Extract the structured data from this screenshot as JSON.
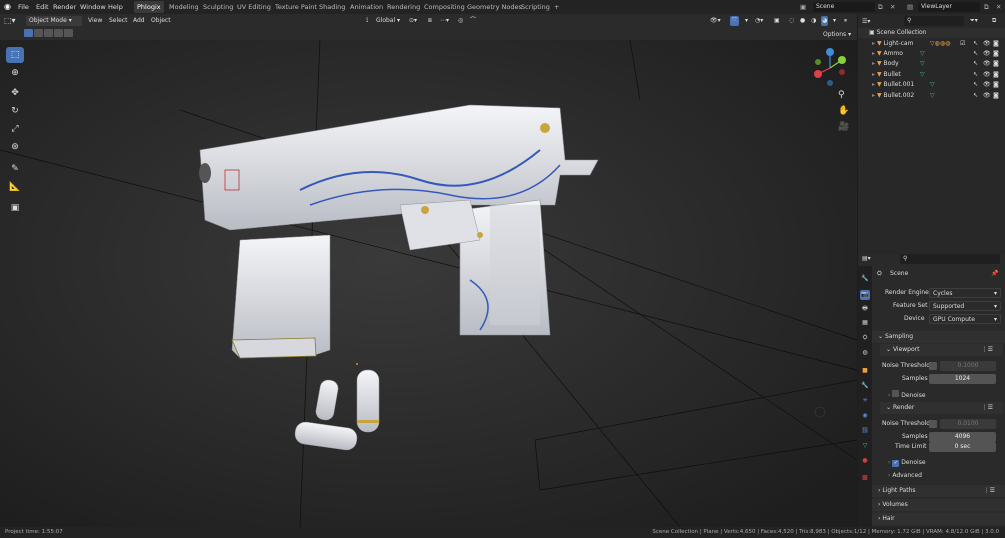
{
  "topbar": {
    "menus": [
      "File",
      "Edit",
      "Render",
      "Window",
      "Help"
    ],
    "workspaces": [
      "Phlogix",
      "Modeling",
      "Sculpting",
      "UV Editing",
      "Texture Paint",
      "Shading",
      "Animation",
      "Rendering",
      "Compositing",
      "Geometry Nodes",
      "Scripting"
    ],
    "active_workspace": "Phlogix",
    "add_tab": "+",
    "scene": "Scene",
    "view_layer": "ViewLayer"
  },
  "viewport_header": {
    "mode": "Object Mode",
    "menus": [
      "View",
      "Select",
      "Add",
      "Object"
    ],
    "transform_orientation": "Global",
    "options": "Options"
  },
  "outliner": {
    "collection": "Scene Collection",
    "items": [
      "Light-cam",
      "Ammo",
      "Body",
      "Bullet",
      "Bullet.001",
      "Bullet.002"
    ]
  },
  "properties": {
    "context": "Scene",
    "render_engine_label": "Render Engine",
    "render_engine": "Cycles",
    "feature_set_label": "Feature Set",
    "feature_set": "Supported",
    "device_label": "Device",
    "device": "GPU Compute",
    "sampling": "Sampling",
    "viewport": "Viewport",
    "vp_noise_threshold_label": "Noise Threshold",
    "vp_noise_threshold": "0.1000",
    "vp_samples_label": "Samples",
    "vp_samples": "1024",
    "vp_denoise": "Denoise",
    "render": "Render",
    "r_noise_threshold_label": "Noise Threshold",
    "r_noise_threshold": "0.0100",
    "r_samples_label": "Samples",
    "r_samples": "4096",
    "time_limit_label": "Time Limit",
    "time_limit": "0 sec",
    "r_denoise": "Denoise",
    "advanced": "Advanced",
    "light_paths": "Light Paths",
    "volumes": "Volumes",
    "hair": "Hair"
  },
  "status": {
    "project_time": "Project time: 1:55:07",
    "stats": "Scene Collection | Plane | Verts:4,650 | Faces:4,520 | Tris:8,983 | Objects:1/12 | Memory: 1.72 GiB | VRAM: 4.8/12.0 GiB | 3.0.0"
  },
  "colors": {
    "accent": "#4772b3",
    "axis_x": "#e0404a",
    "axis_y": "#8ccf3c",
    "axis_z": "#3c8fd8"
  }
}
